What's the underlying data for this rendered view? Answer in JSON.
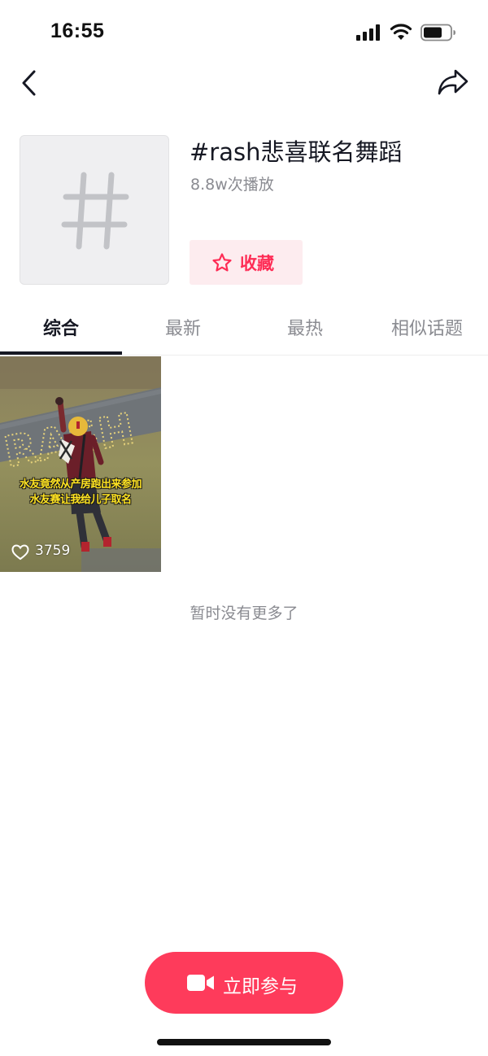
{
  "status_bar": {
    "time": "16:55",
    "icons": [
      "signal-icon",
      "wifi-icon",
      "battery-icon"
    ]
  },
  "nav": {
    "back_icon": "chevron-left-icon",
    "share_icon": "share-arrow-icon"
  },
  "topic": {
    "cover_icon": "hashtag-icon",
    "title": "#rash悲喜联名舞蹈",
    "play_count": "8.8w次播放",
    "favorite": {
      "icon": "star-outline-icon",
      "label": "收藏"
    }
  },
  "tabs": [
    {
      "label": "综合",
      "active": true
    },
    {
      "label": "最新",
      "active": false
    },
    {
      "label": "最热",
      "active": false
    },
    {
      "label": "相似话题",
      "active": false
    }
  ],
  "videos": [
    {
      "caption_line1": "水友竟然从产房跑出来参加",
      "caption_line2": "水友赛让我给儿子取名",
      "overlay_text": "RASH",
      "like_icon": "heart-outline-icon",
      "likes": "3759"
    }
  ],
  "empty_hint": "暂时没有更多了",
  "join_button": {
    "icon": "video-camera-icon",
    "label": "立即参与"
  },
  "colors": {
    "accent": "#fe2c55",
    "join_button": "#fe3b5b",
    "favorite_bg": "#fdecef",
    "text_primary": "#161823",
    "text_secondary": "#8a8b91",
    "caption_yellow": "#ffe321"
  }
}
